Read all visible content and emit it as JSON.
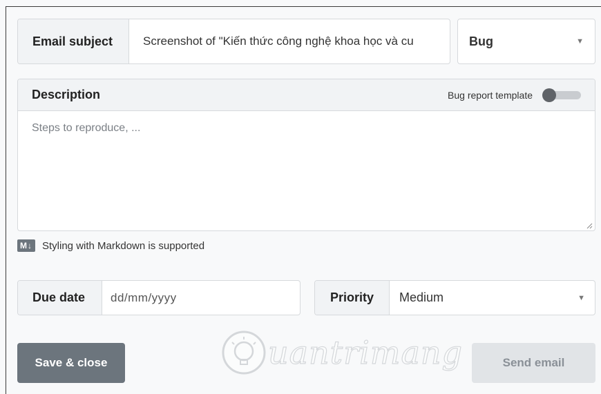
{
  "form": {
    "subject": {
      "label": "Email subject",
      "value": "Screenshot of \"Kiến thức công nghệ khoa học và cu"
    },
    "type_select": {
      "value": "Bug"
    },
    "description": {
      "title": "Description",
      "template_toggle_label": "Bug report template",
      "template_toggle_on": false,
      "placeholder": "Steps to reproduce, ..."
    },
    "markdown_note": {
      "badge": "M↓",
      "text": "Styling with Markdown is supported"
    },
    "due_date": {
      "label": "Due date",
      "placeholder": "dd/mm/yyyy"
    },
    "priority": {
      "label": "Priority",
      "value": "Medium"
    },
    "buttons": {
      "save_close": "Save & close",
      "send_email": "Send email"
    }
  },
  "watermark": {
    "text": "uantrimang"
  },
  "colors": {
    "background": "#f8f9fa",
    "addon_bg": "#f1f3f5",
    "border": "#d6d9dc",
    "save_button": "#6c757d",
    "send_button_disabled": "#e1e4e7"
  }
}
